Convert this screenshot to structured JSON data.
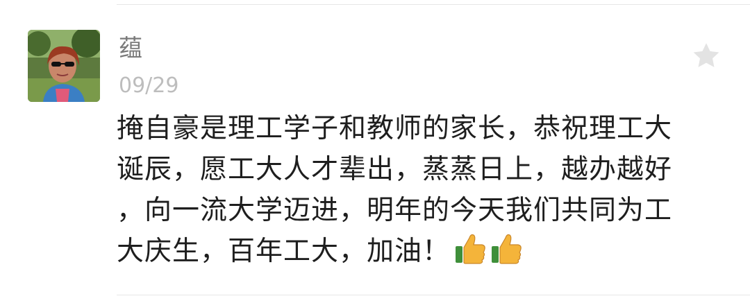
{
  "post": {
    "author_name": "蕴",
    "date": "09/29",
    "content_lines": [
      "掩自豪是理工学子和教师的家长，恭祝理工大",
      "诞辰，愿工大人才辈出，蒸蒸日上，越办越好",
      "，向一流大学迈进，明年的今天我们共同为工",
      "大庆生，百年工大，加油！"
    ],
    "emoji_icons": [
      "thumbs-up-icon",
      "thumbs-up-icon"
    ]
  },
  "colors": {
    "name": "#7a7a7a",
    "date": "#bdbdbd",
    "text": "#1e1e1e",
    "star": "#e3e3e3",
    "thumb": "#f4b43a"
  }
}
